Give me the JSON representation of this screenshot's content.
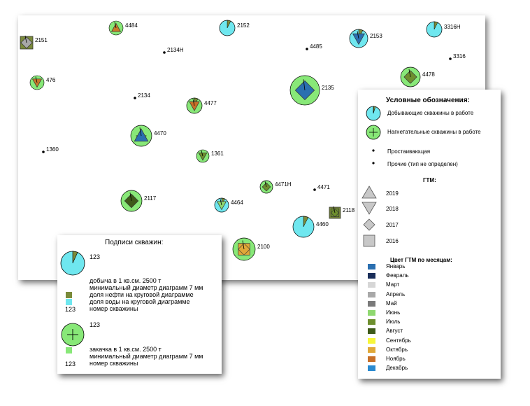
{
  "wells": [
    {
      "id": "2151",
      "type": "square",
      "color": "#7a8a3a"
    },
    {
      "id": "4484",
      "type": "tri-up",
      "color": "#c8792a"
    },
    {
      "id": "2152",
      "type": "pie",
      "color": "#6fe7ef"
    },
    {
      "id": "2153",
      "type": "pie",
      "color": "#6fe7ef"
    },
    {
      "id": "3316H",
      "type": "pie",
      "color": "#6fe7ef"
    },
    {
      "id": "2134H",
      "type": "dot"
    },
    {
      "id": "4485",
      "type": "dot"
    },
    {
      "id": "3316",
      "type": "dot"
    },
    {
      "id": "476",
      "type": "tri-down",
      "color": "#c8792a"
    },
    {
      "id": "4478",
      "type": "inj",
      "color": "#88e878"
    },
    {
      "id": "2134",
      "type": "dot"
    },
    {
      "id": "4477",
      "type": "pie",
      "color": "#88e878"
    },
    {
      "id": "2135",
      "type": "inj",
      "color": "#88e878"
    },
    {
      "id": "4470",
      "type": "inj",
      "color": "#88e878"
    },
    {
      "id": "1360",
      "type": "dot"
    },
    {
      "id": "1361",
      "type": "tri-down",
      "color": "#7a8a3a"
    },
    {
      "id": "4471H",
      "type": "inj",
      "color": "#88e878"
    },
    {
      "id": "4471",
      "type": "dot"
    },
    {
      "id": "2117",
      "type": "inj",
      "color": "#88e878"
    },
    {
      "id": "4464",
      "type": "pie",
      "color": "#6fe7ef"
    },
    {
      "id": "2118",
      "type": "square",
      "color": "#7a8a3a"
    },
    {
      "id": "4460",
      "type": "pie",
      "color": "#6fe7ef"
    },
    {
      "id": "2100",
      "type": "inj",
      "color": "#88e878"
    }
  ],
  "legend": {
    "title": "Условные обозначения:",
    "producing": "Добывающие скважины в работе",
    "injection": "Нагнетательные скважины в работе",
    "idle": "Простаивающая",
    "other": "Прочие (тип не определен)",
    "gtm_title": "ГТМ:",
    "years": [
      "2019",
      "2018",
      "2017",
      "2016"
    ],
    "months_title": "Цвет ГТМ по месяцам:",
    "months": [
      {
        "name": "Январь",
        "color": "#2a6fb0"
      },
      {
        "name": "Февраль",
        "color": "#1a2e5a"
      },
      {
        "name": "Март",
        "color": "#d6d6d6"
      },
      {
        "name": "Апрель",
        "color": "#a8a8a8"
      },
      {
        "name": "Май",
        "color": "#7a7a7a"
      },
      {
        "name": "Июнь",
        "color": "#8fd870"
      },
      {
        "name": "Июль",
        "color": "#6e8f2e"
      },
      {
        "name": "Август",
        "color": "#3e5a1a"
      },
      {
        "name": "Сентябрь",
        "color": "#f6f63a"
      },
      {
        "name": "Октябрь",
        "color": "#e0a838"
      },
      {
        "name": "Ноябрь",
        "color": "#c87028"
      },
      {
        "name": "Декабрь",
        "color": "#2a8ad0"
      }
    ]
  },
  "labels_panel": {
    "title": "Подписи скважин:",
    "prod_number": "123",
    "prod_lines": [
      "добыча в 1 кв.см. 2500 т",
      "минимальный диаметр диаграмм 7 мм",
      "доля нефти на круговой диаграмме",
      "доля воды на круговой диаграмме",
      "номер скважины"
    ],
    "prod_number_bottom": "123",
    "inj_number": "123",
    "inj_lines": [
      "закачка в 1 кв.см. 2500 т",
      "минимальный диаметр диаграмм 7 мм",
      "номер скважины"
    ],
    "inj_number_bottom": "123"
  },
  "colors": {
    "producing": "#6fe7ef",
    "injection": "#88e878",
    "oil": "#7a8a3a",
    "water": "#6fe7ef"
  }
}
